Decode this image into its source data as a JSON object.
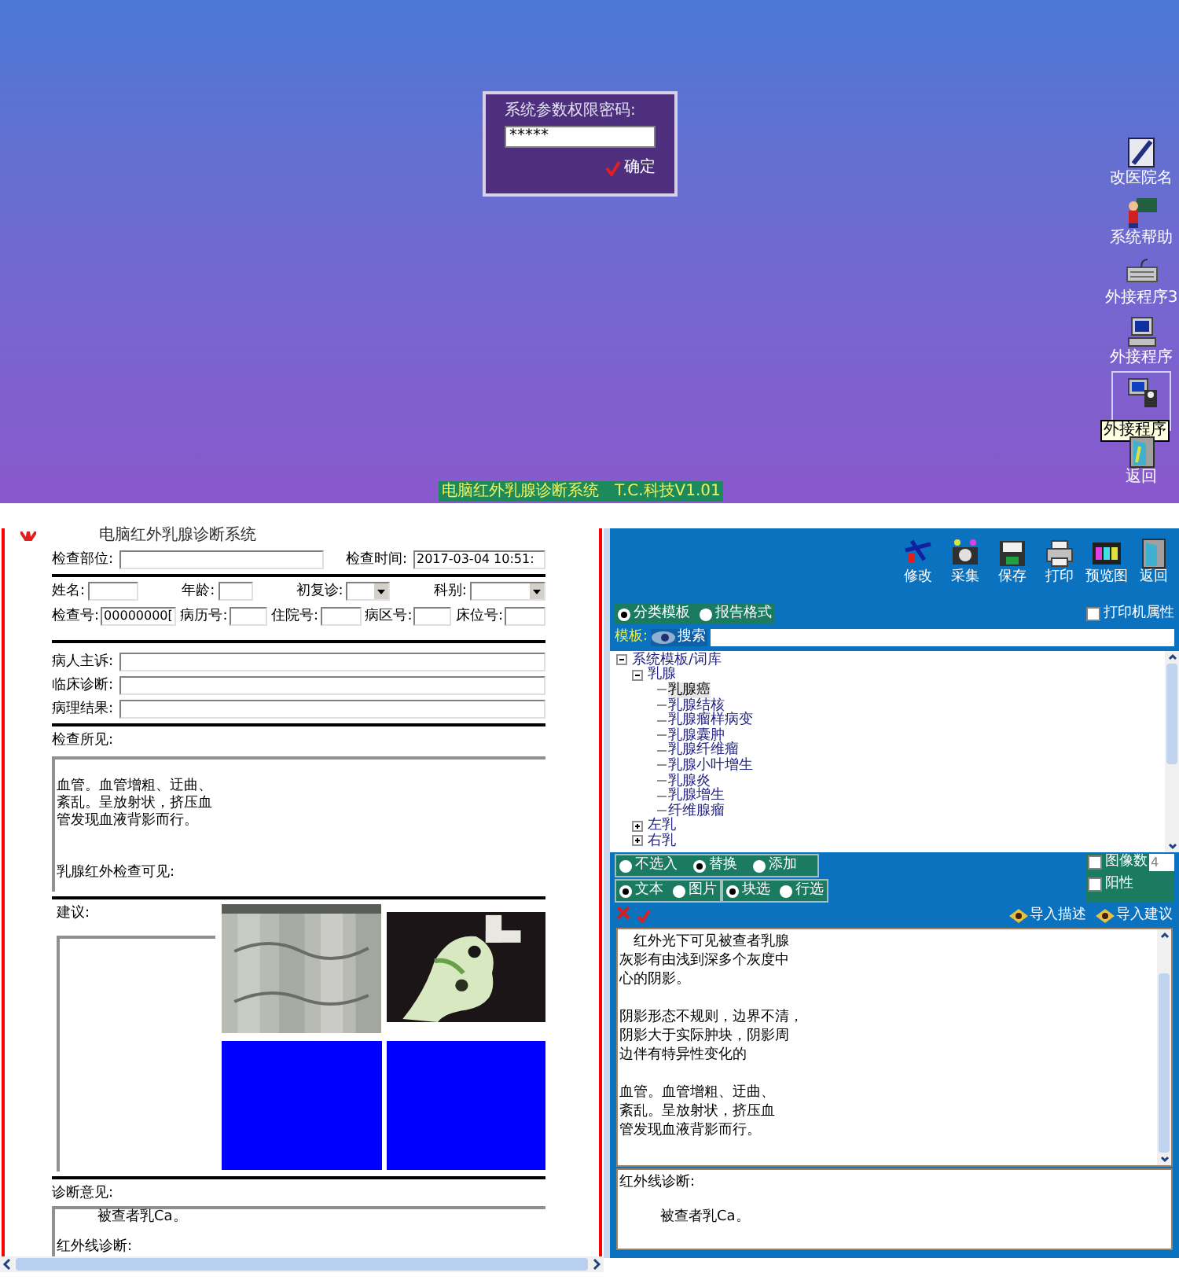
{
  "desktop": {
    "password_dialog": {
      "label": "系统参数权限密码:",
      "value": "*****",
      "ok_button": "确定"
    },
    "icons": [
      {
        "kind": "pen",
        "label": "改医院名",
        "selected": false
      },
      {
        "kind": "teacher",
        "label": "系统帮助",
        "selected": false
      },
      {
        "kind": "keyboard",
        "label": "外接程序3",
        "selected": false
      },
      {
        "kind": "computer",
        "label": "外接程序",
        "selected": false
      },
      {
        "kind": "network",
        "selected": true,
        "tooltip": "外接程序"
      },
      {
        "kind": "door",
        "label": "返回",
        "selected": false
      }
    ],
    "status_text": "电脑红外乳腺诊断系统　T.C.科技V1.01"
  },
  "report_form": {
    "title": "电脑红外乳腺诊断系统",
    "exam_site": {
      "label": "检查部位:"
    },
    "exam_time": {
      "label": "检查时间:",
      "value": "2017-03-04 10:51:"
    },
    "row_1": [
      {
        "kind": "input",
        "label": "姓名:"
      },
      {
        "kind": "input",
        "label": "年龄:"
      },
      {
        "kind": "select",
        "label": "初复诊:"
      },
      {
        "kind": "select",
        "label": "科别:"
      }
    ],
    "row_2": [
      {
        "label": "检查号:",
        "value": "00000000["
      },
      {
        "label": "病历号:"
      },
      {
        "label": "住院号:"
      },
      {
        "label": "病区号:"
      },
      {
        "label": "床位号:"
      }
    ],
    "history_fields": [
      {
        "label": "病人主诉:"
      },
      {
        "label": "临床诊断:"
      },
      {
        "label": "病理结果:"
      }
    ],
    "findings": {
      "label": "检查所见:",
      "paragraphs": [
        [
          "血管。血管增粗、迂曲、",
          "紊乱。呈放射状，挤压血",
          "管发现血液背影而行。"
        ],
        [
          "乳腺红外检查可见:"
        ]
      ]
    },
    "advice": {
      "label": "建议:"
    },
    "images": [
      {
        "kind": "picture"
      },
      {
        "kind": "picture"
      },
      {
        "kind": "blank"
      },
      {
        "kind": "blank"
      }
    ],
    "diagnosis": {
      "label": "诊断意见:",
      "lines": [
        "被查者乳Ca。",
        "红外线诊断:"
      ]
    }
  },
  "editor_panel": {
    "toolbar": [
      "修改",
      "采集",
      "保存",
      "打印",
      "预览图",
      "返回"
    ],
    "template_modes": [
      {
        "label": "分类模板",
        "selected": true
      },
      {
        "label": "报告格式",
        "selected": false
      }
    ],
    "printer_properties": {
      "label": "打印机属性",
      "checked": false
    },
    "template_search": {
      "label": "模板:",
      "button": "搜索"
    },
    "tree": [
      {
        "label": "系统模板/词库",
        "expanded": true,
        "children": [
          {
            "label": "乳腺",
            "expanded": true,
            "children": [
              {
                "label": "乳腺癌",
                "selected": true
              },
              {
                "label": "乳腺结核",
                "selected": false
              },
              {
                "label": "乳腺瘤样病变",
                "selected": false
              },
              {
                "label": "乳腺囊肿",
                "selected": false
              },
              {
                "label": "乳腺纤维瘤",
                "selected": false
              },
              {
                "label": "乳腺小叶增生",
                "selected": false
              },
              {
                "label": "乳腺炎",
                "selected": false
              },
              {
                "label": "乳腺增生",
                "selected": false
              },
              {
                "label": "纤维腺瘤",
                "selected": false
              }
            ]
          },
          {
            "label": "左乳",
            "expanded": false
          },
          {
            "label": "右乳",
            "expanded": false
          }
        ]
      }
    ],
    "insert_modes": [
      {
        "label": "不选入",
        "selected": false
      },
      {
        "label": "替换",
        "selected": true
      },
      {
        "label": "添加",
        "selected": false
      }
    ],
    "content_types": [
      {
        "label": "文本",
        "selected": true
      },
      {
        "label": "图片",
        "selected": false
      }
    ],
    "select_modes": [
      {
        "label": "块选",
        "selected": true
      },
      {
        "label": "行选",
        "selected": false
      }
    ],
    "image_count": {
      "label": "图像数",
      "checked": false,
      "value": "4"
    },
    "positive": {
      "label": "阳性",
      "checked": false
    },
    "import_buttons": [
      "导入描述",
      "导入建议"
    ],
    "description_paragraphs": [
      [
        "　红外光下可见被查者乳腺",
        "灰影有由浅到深多个灰度中",
        "心的阴影。"
      ],
      [
        "阴影形态不规则，边界不清，",
        "阴影大于实际肿块，阴影周",
        "边伴有特异性变化的"
      ],
      [
        "血管。血管增粗、迂曲、",
        "紊乱。呈放射状，挤压血",
        "管发现血液背影而行。"
      ]
    ],
    "diagnosis_lines": [
      "红外线诊断:",
      "被查者乳Ca。"
    ]
  }
}
